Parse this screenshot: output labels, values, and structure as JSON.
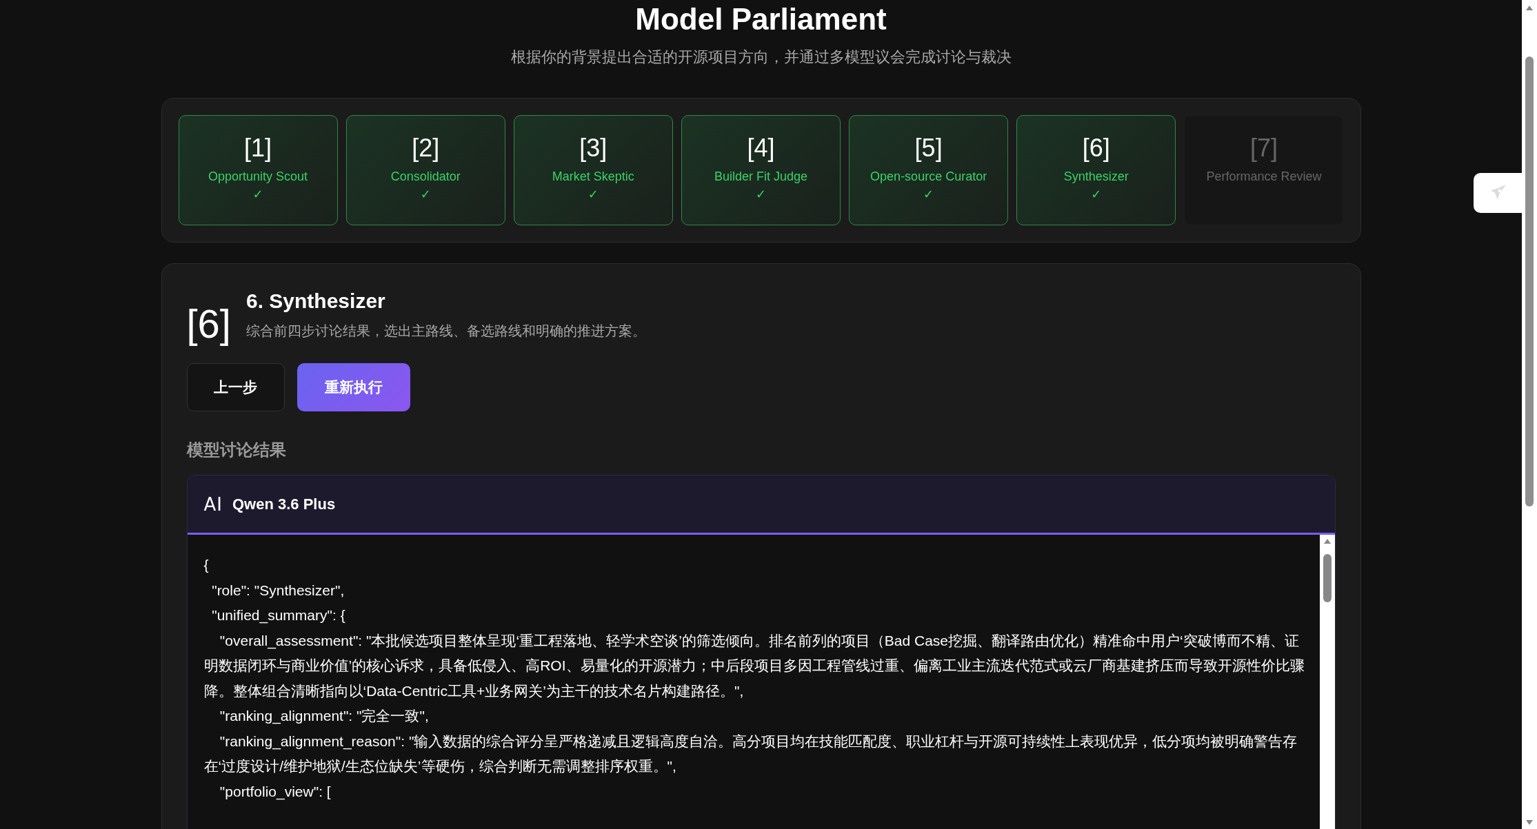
{
  "header": {
    "title": "Model Parliament",
    "subtitle": "根据你的背景提出合适的开源项目方向，并通过多模型议会完成讨论与裁决"
  },
  "steps": [
    {
      "number": "[1]",
      "name": "Opportunity Scout",
      "completed": true,
      "mark": "✓"
    },
    {
      "number": "[2]",
      "name": "Consolidator",
      "completed": true,
      "mark": "✓"
    },
    {
      "number": "[3]",
      "name": "Market Skeptic",
      "completed": true,
      "mark": "✓"
    },
    {
      "number": "[4]",
      "name": "Builder Fit Judge",
      "completed": true,
      "mark": "✓"
    },
    {
      "number": "[5]",
      "name": "Open-source Curator",
      "completed": true,
      "mark": "✓"
    },
    {
      "number": "[6]",
      "name": "Synthesizer",
      "completed": true,
      "mark": "✓"
    },
    {
      "number": "[7]",
      "name": "Performance Review",
      "completed": false
    }
  ],
  "detail": {
    "badge": "[6]",
    "title": "6. Synthesizer",
    "description": "综合前四步讨论结果，选出主路线、备选路线和明确的推进方案。",
    "buttons": [
      {
        "label": "上一步",
        "kind": "secondary"
      },
      {
        "label": "重新执行",
        "kind": "primary"
      }
    ],
    "section_title": "模型讨论结果",
    "model": {
      "icon_text": "AI",
      "name": "Qwen 3.6 Plus",
      "lines": [
        "{",
        "  \"role\": \"Synthesizer\",",
        "  \"unified_summary\": {",
        "    \"overall_assessment\": \"本批候选项目整体呈现‘重工程落地、轻学术空谈’的筛选倾向。排名前列的项目（Bad Case挖掘、翻译路由优化）精准命中用户‘突破博而不精、证明数据闭环与商业价值’的核心诉求，具备低侵入、高ROI、易量化的开源潜力；中后段项目多因工程管线过重、偏离工业主流迭代范式或云厂商基建挤压而导致开源性价比骤降。整体组合清晰指向以‘Data-Centric工具+业务网关’为主干的技术名片构建路径。\",",
        "    \"ranking_alignment\": \"完全一致\",",
        "    \"ranking_alignment_reason\": \"输入数据的综合评分呈严格递减且逻辑高度自洽。高分项目均在技能匹配度、职业杠杆与开源可持续性上表现优异，低分项均被明确警告存在‘过度设计/维护地狱/生态位缺失’等硬伤，综合判断无需调整排序权重。\",",
        "    \"portfolio_view\": ["
      ]
    }
  }
}
